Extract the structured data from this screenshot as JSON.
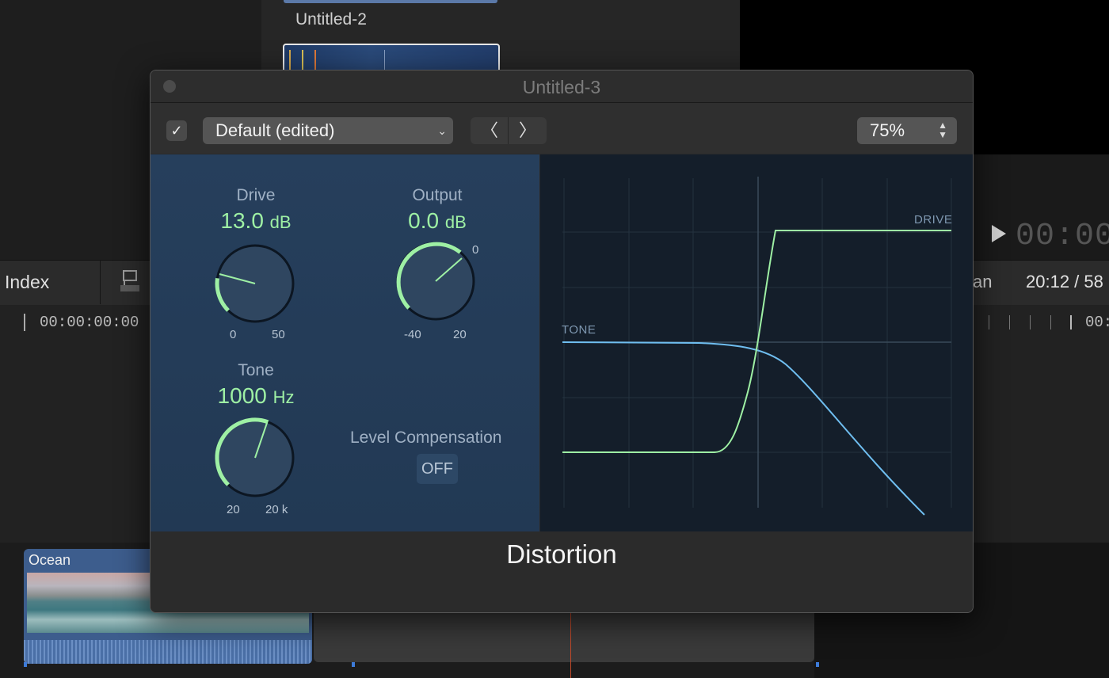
{
  "background": {
    "browser_clip_label": "Untitled-2",
    "toolbar_index_label": "Index",
    "toolbar_partial_label": "an",
    "toolbar_duration": "20:12 / 58",
    "viewer_timecode": "00:00:",
    "ruler_start_timecode": "00:00:00:00",
    "ruler_right_timecode": "00:",
    "timeline_clip_name": "Ocean"
  },
  "window": {
    "title": "Untitled-3",
    "bypass_checkbox": "✓",
    "preset_value": "Default (edited)",
    "preset_chevron": "⌄",
    "prev_label": "〈",
    "next_label": "〉",
    "zoom_value": "75%",
    "zoom_stepper_up": "▲",
    "zoom_stepper_down": "▼"
  },
  "controls": {
    "drive": {
      "title": "Drive",
      "value": "13.0",
      "unit": "dB",
      "min": "0",
      "max": "50"
    },
    "output": {
      "title": "Output",
      "value": "0.0",
      "unit": "dB",
      "min": "-40",
      "max": "20",
      "center": "0"
    },
    "tone": {
      "title": "Tone",
      "value": "1000",
      "unit": "Hz",
      "min": "20",
      "max": "20 k"
    },
    "level_compensation": {
      "title": "Level Compensation",
      "state": "OFF"
    }
  },
  "graph": {
    "drive_label": "DRIVE",
    "tone_label": "TONE",
    "drive_color": "#9ef0a4",
    "tone_color": "#6fbef0"
  },
  "footer": {
    "plugin_name": "Distortion"
  },
  "colors": {
    "accent_green": "#9ef0a4",
    "panel_blue": "#263f5c",
    "graph_bg": "#141e2a"
  }
}
